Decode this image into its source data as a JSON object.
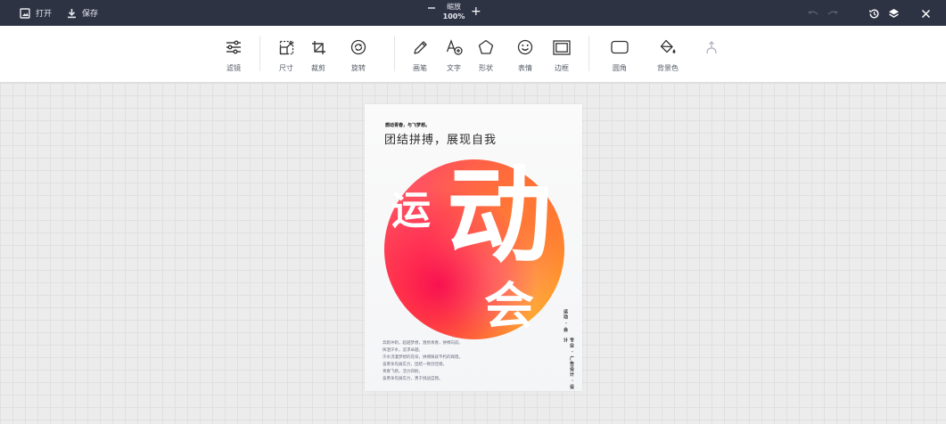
{
  "topbar": {
    "open_label": "打开",
    "save_label": "保存",
    "zoom_label": "缩放",
    "zoom_value": "100%",
    "zoom_in_glyph": "+"
  },
  "toolbar": {
    "items": [
      {
        "label": "滤镜",
        "icon": "sliders-icon"
      },
      {
        "label": "尺寸",
        "icon": "resize-icon"
      },
      {
        "label": "裁剪",
        "icon": "crop-icon"
      },
      {
        "label": "旋转",
        "icon": "rotate-icon"
      },
      {
        "label": "画笔",
        "icon": "pencil-icon"
      },
      {
        "label": "文字",
        "icon": "text-add-icon"
      },
      {
        "label": "形状",
        "icon": "pentagon-icon"
      },
      {
        "label": "表情",
        "icon": "smiley-icon"
      },
      {
        "label": "边框",
        "icon": "frame-icon"
      },
      {
        "label": "圆角",
        "icon": "rounded-rect-icon"
      },
      {
        "label": "背景色",
        "icon": "paint-bucket-icon"
      }
    ]
  },
  "poster": {
    "small_title": "燃动青春，与飞梦想。",
    "headline": "团结拼搏，展现自我",
    "char_yun": "运",
    "char_dong": "动",
    "char_hui": "会",
    "body_lines": [
      "奔跑冲刺，超越梦想，激扬青春，拼搏向前。",
      "挥洒汗水，追求卓越。",
      "汗水浇灌梦想的花朵，拼搏铸就不朽的辉煌。",
      "奋勇争先展实力，团结一致创佳绩。",
      "青春飞扬，活力四射。",
      "奋勇争先展实力，勇于挑战自我。"
    ],
    "vertical_1": "运动 · 会",
    "vertical_2": "专业 · 广告设计 · 设计"
  },
  "colors": {
    "topbar_bg": "#2e3344",
    "toolbar_bg": "#ffffff",
    "canvas_bg": "#ececec",
    "blob_primary": "#ff3d60",
    "blob_secondary": "#f2a53a"
  }
}
